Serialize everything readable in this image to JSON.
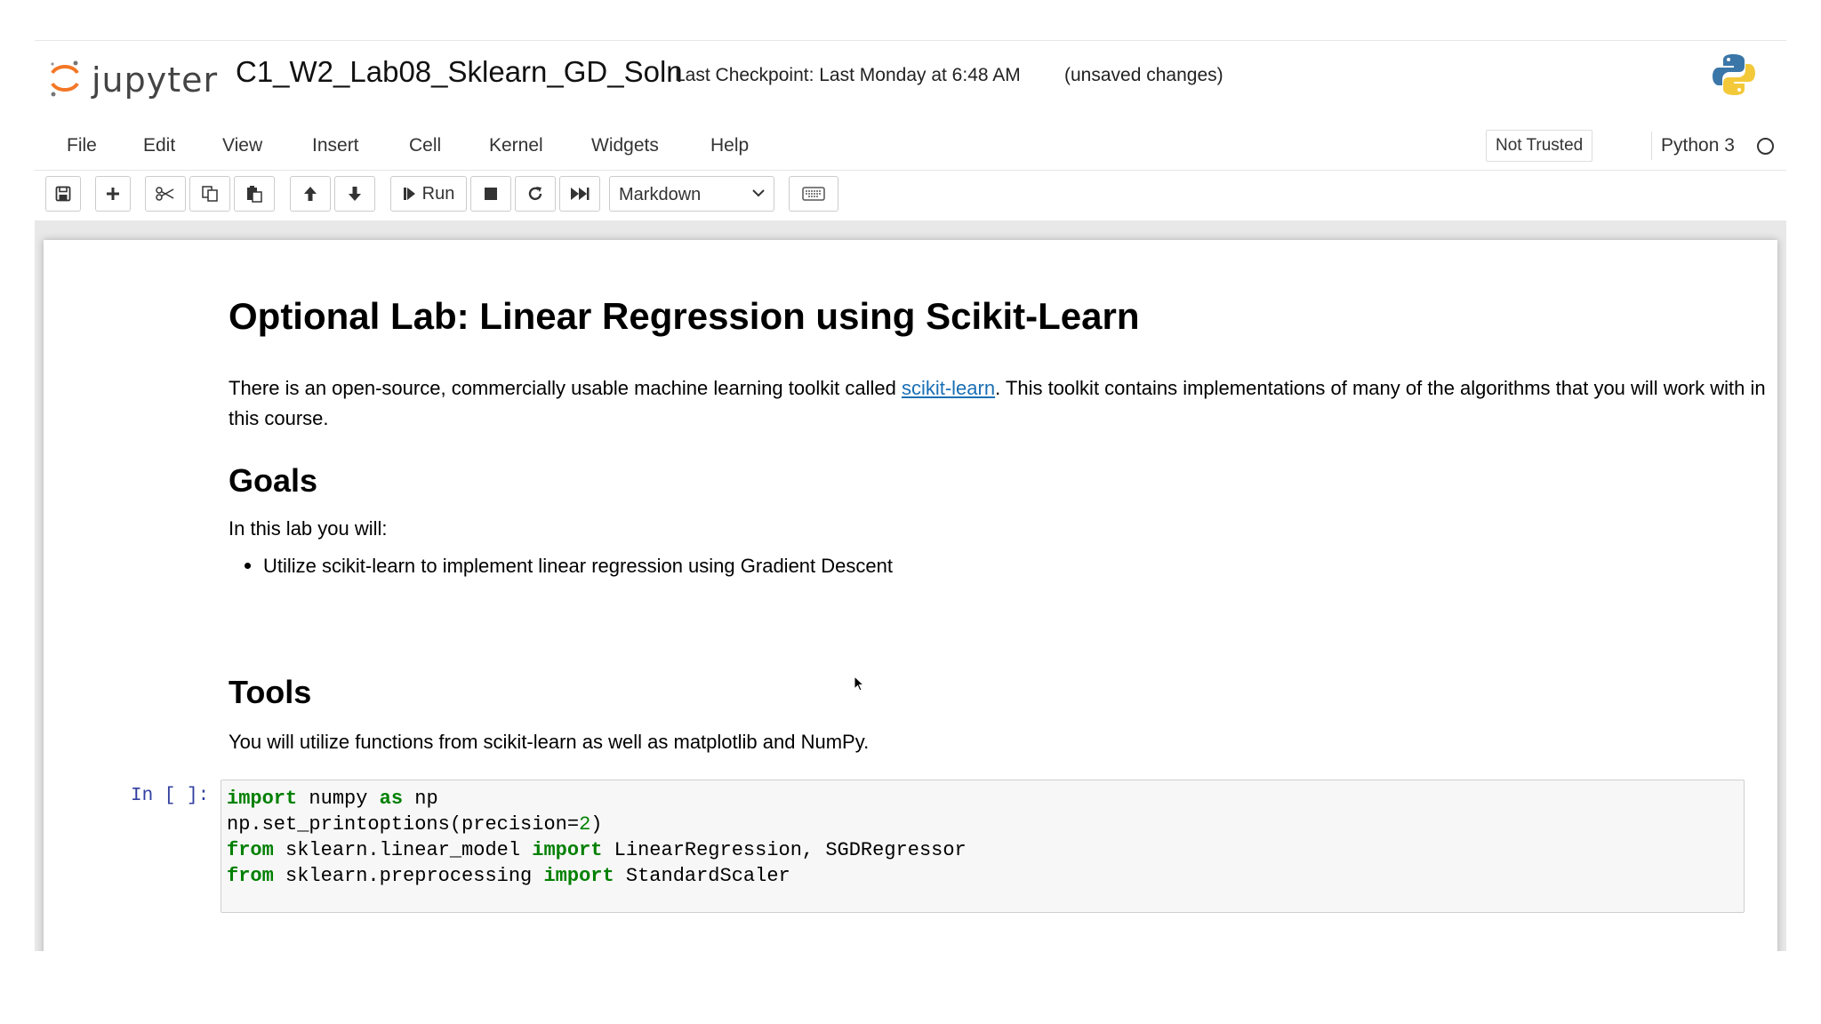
{
  "header": {
    "logo_text": "jupyter",
    "notebook_title": "C1_W2_Lab08_Sklearn_GD_Soln",
    "checkpoint": "Last Checkpoint: Last Monday at 6:48 AM",
    "unsaved": "(unsaved changes)"
  },
  "menubar": {
    "items": [
      "File",
      "Edit",
      "View",
      "Insert",
      "Cell",
      "Kernel",
      "Widgets",
      "Help"
    ],
    "trust_status": "Not Trusted",
    "kernel_name": "Python 3"
  },
  "toolbar": {
    "buttons": [
      "save-icon",
      "add-cell-icon",
      "cut-icon",
      "copy-icon",
      "paste-icon",
      "move-up-icon",
      "move-down-icon",
      "run-icon",
      "stop-icon",
      "restart-icon",
      "fast-forward-icon",
      "keyboard-icon"
    ],
    "run_label": "Run",
    "cell_type": "Markdown"
  },
  "notebook": {
    "title": "Optional Lab: Linear Regression using Scikit-Learn",
    "intro_before_link": "There is an open-source, commercially usable machine learning toolkit called ",
    "intro_link": "scikit-learn",
    "intro_after_link": ". This toolkit contains implementations of many of the algorithms that you will work with in this course.",
    "goals_heading": "Goals",
    "goals_text": "In this lab you will:",
    "goals_bullet": "Utilize scikit-learn to implement linear regression using Gradient Descent",
    "tools_heading": "Tools",
    "tools_text": "You will utilize functions from scikit-learn as well as matplotlib and NumPy.",
    "code_prompt": "In [ ]:",
    "code": {
      "line1_kw1": "import",
      "line1_a": " numpy ",
      "line1_kw2": "as",
      "line1_b": " np",
      "line2_a": "np.set_printoptions(precision=",
      "line2_num": "2",
      "line2_b": ")",
      "line3_kw1": "from",
      "line3_a": " sklearn.linear_model ",
      "line3_kw2": "import",
      "line3_b": " LinearRegression, SGDRegressor",
      "line4_kw1": "from",
      "line4_a": " sklearn.preprocessing ",
      "line4_kw2": "import",
      "line4_b": " StandardScaler"
    }
  },
  "colors": {
    "jupyter_orange": "#f37726",
    "link": "#1a6fb5",
    "keyword": "#008000",
    "prompt": "#303f9f"
  }
}
